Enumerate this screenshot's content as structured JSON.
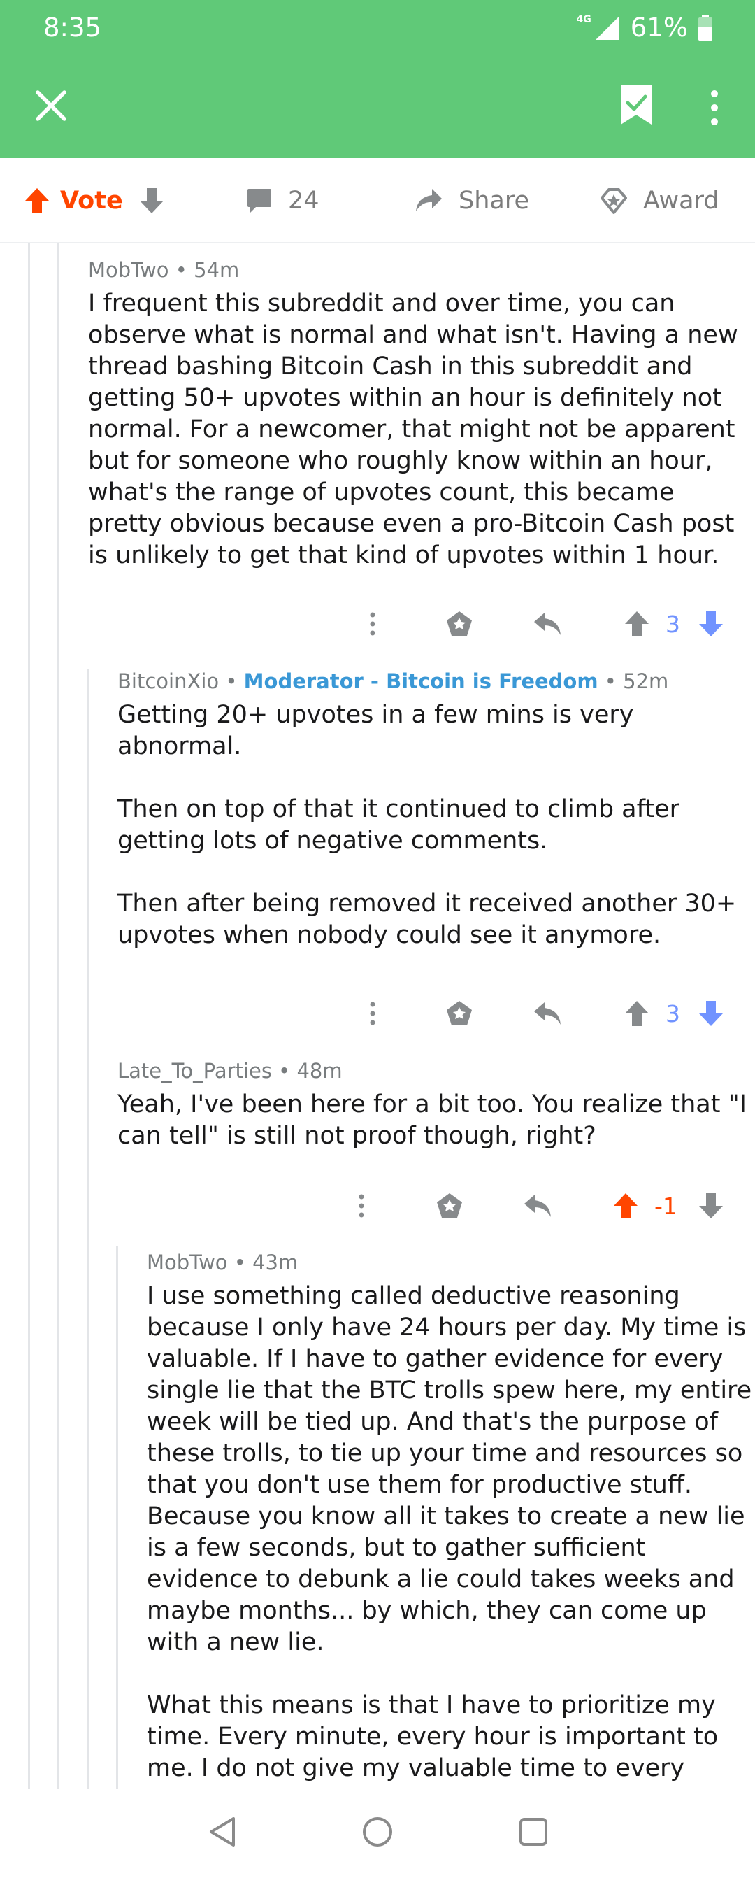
{
  "status_bar": {
    "time": "8:35",
    "network": "4G",
    "battery": "61%"
  },
  "app_bar": {
    "close_icon": "close-icon",
    "save_icon": "bookmark-check-icon",
    "more_icon": "more-vertical-icon"
  },
  "action_bar": {
    "vote_label": "Vote",
    "comments_count": "24",
    "share_label": "Share",
    "award_label": "Award"
  },
  "comments": [
    {
      "author": "MobTwo",
      "flair": "",
      "age": "54m",
      "paragraphs": [
        "I frequent this subreddit and over time, you can observe what is normal and what isn't. Having a new thread bashing Bitcoin Cash in this subreddit and getting 50+ upvotes within an hour is definitely not normal. For a newcomer, that might not be apparent but for someone who roughly know within an hour, what's the range of upvotes count, this became pretty obvious because even a pro-Bitcoin Cash post is unlikely to get that kind of upvotes within 1 hour."
      ],
      "score": "3",
      "vote_state": "none"
    },
    {
      "author": "BitcoinXio",
      "flair": "Moderator - Bitcoin is Freedom",
      "age": "52m",
      "paragraphs": [
        "Getting 20+ upvotes in a few mins is very abnormal.",
        "Then on top of that it continued to climb after getting lots of negative comments.",
        "Then after being removed it received another 30+ upvotes when nobody could see it anymore."
      ],
      "score": "3",
      "vote_state": "none"
    },
    {
      "author": "Late_To_Parties",
      "flair": "",
      "age": "48m",
      "paragraphs": [
        "Yeah, I've been here for a bit too. You realize that \"I can tell\" is still not proof though, right?"
      ],
      "score": "-1",
      "vote_state": "none"
    },
    {
      "author": "MobTwo",
      "flair": "",
      "age": "43m",
      "paragraphs": [
        "I use something called deductive reasoning because I only have 24 hours per day. My time is valuable. If I have to gather evidence for every single lie that the BTC trolls spew here, my entire week will be tied up. And that's the purpose of these trolls, to tie up your time and resources so that you don't use them for productive stuff. Because you know all it takes to create a new lie is a few seconds, but to gather sufficient evidence to debunk a lie could takes weeks and maybe months... by which, they can come up with a new lie.",
        "What this means is that I have to prioritize my time. Every minute, every hour is important to me. I do not give my valuable time to every"
      ]
    }
  ],
  "colors": {
    "header": "#60c978",
    "upvote_orange": "#ff4500",
    "downvote_blue": "#7193ff",
    "flair_blue": "#3a98d6",
    "muted_gray": "#787c7e"
  },
  "nav_bar": {
    "back_icon": "back-triangle-icon",
    "home_icon": "home-circle-icon",
    "recents_icon": "recents-square-icon"
  }
}
